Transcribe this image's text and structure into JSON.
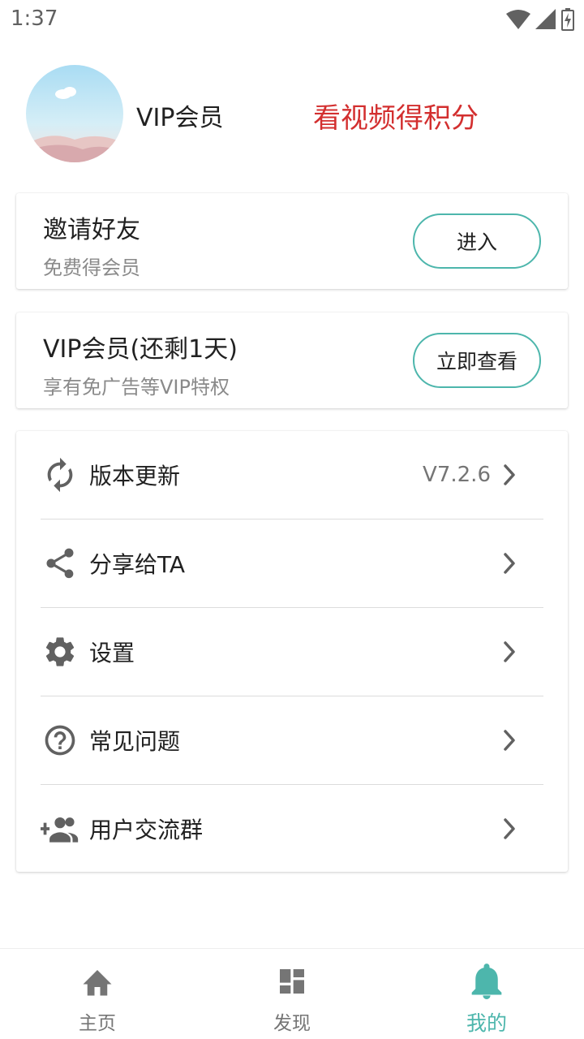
{
  "status_bar": {
    "time": "1:37",
    "icons": [
      "wifi-icon",
      "signal-icon",
      "battery-icon"
    ]
  },
  "profile": {
    "avatar": "landscape-avatar",
    "name": "VIP会员",
    "promo": "看视频得积分",
    "promo_color": "#d32f2f"
  },
  "invite_card": {
    "title": "邀请好友",
    "subtitle": "免费得会员",
    "button": "进入"
  },
  "vip_card": {
    "title": "VIP会员(还剩1天)",
    "subtitle": "享有免广告等VIP特权",
    "button": "立即查看"
  },
  "menu": {
    "items": [
      {
        "icon": "refresh-icon",
        "label": "版本更新",
        "value": "V7.2.6"
      },
      {
        "icon": "share-icon",
        "label": "分享给TA",
        "value": ""
      },
      {
        "icon": "gear-icon",
        "label": "设置",
        "value": ""
      },
      {
        "icon": "help-circle-icon",
        "label": "常见问题",
        "value": ""
      },
      {
        "icon": "group-add-icon",
        "label": "用户交流群",
        "value": ""
      }
    ]
  },
  "bottom_nav": {
    "items": [
      {
        "icon": "home-icon",
        "label": "主页",
        "active": false
      },
      {
        "icon": "dashboard-icon",
        "label": "发现",
        "active": false
      },
      {
        "icon": "bell-icon",
        "label": "我的",
        "active": true
      }
    ]
  },
  "colors": {
    "accent": "#4db6ac",
    "inactive": "#757575",
    "promo": "#d32f2f"
  }
}
